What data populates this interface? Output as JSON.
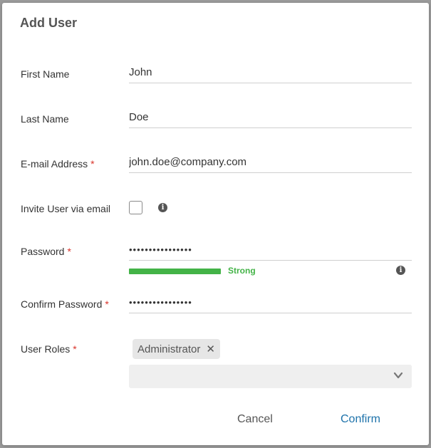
{
  "backdrop": {
    "partial_text": "Administrator"
  },
  "dialog": {
    "title": "Add User",
    "fields": {
      "first_name": {
        "label": "First Name",
        "value": "John"
      },
      "last_name": {
        "label": "Last Name",
        "value": "Doe"
      },
      "email": {
        "label": "E-mail Address",
        "required_mark": "*",
        "value": "john.doe@company.com"
      },
      "invite": {
        "label": "Invite User via email",
        "checked": false
      },
      "password": {
        "label": "Password",
        "required_mark": "*",
        "value": "••••••••••••••••"
      },
      "strength": {
        "label": "Strong",
        "level": 1.0,
        "color": "#43b347"
      },
      "confirm_password": {
        "label": "Confirm Password",
        "required_mark": "*",
        "value": "••••••••••••••••"
      },
      "roles": {
        "label": "User Roles",
        "required_mark": "*",
        "selected": [
          "Administrator"
        ],
        "remove_glyph": "✕"
      }
    },
    "buttons": {
      "cancel": "Cancel",
      "confirm": "Confirm"
    },
    "info_glyph": "i"
  },
  "colors": {
    "required": "#d9342b",
    "accent": "#1d72aa",
    "success": "#43b347"
  }
}
